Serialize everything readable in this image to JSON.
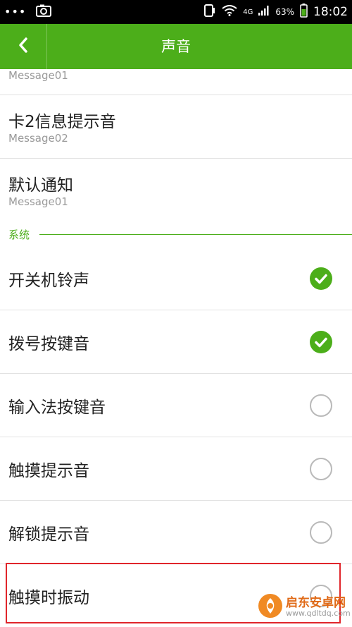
{
  "status": {
    "battery": "63%",
    "network": "4G",
    "time": "18:02"
  },
  "header": {
    "title": "声音"
  },
  "list": {
    "partial_sub": "Message01",
    "card2": {
      "label": "卡2信息提示音",
      "sub": "Message02"
    },
    "default_notify": {
      "label": "默认通知",
      "sub": "Message01"
    },
    "section_title": "系统",
    "items": [
      {
        "label": "开关机铃声",
        "checked": true
      },
      {
        "label": "拨号按键音",
        "checked": true
      },
      {
        "label": "输入法按键音",
        "checked": false
      },
      {
        "label": "触摸提示音",
        "checked": false
      },
      {
        "label": "解锁提示音",
        "checked": false
      },
      {
        "label": "触摸时振动",
        "checked": false
      }
    ]
  },
  "watermark": {
    "title": "启东安卓网",
    "url": "www.qdltdq.com"
  },
  "colors": {
    "accent": "#4cae1a",
    "highlight": "#e0252b"
  }
}
